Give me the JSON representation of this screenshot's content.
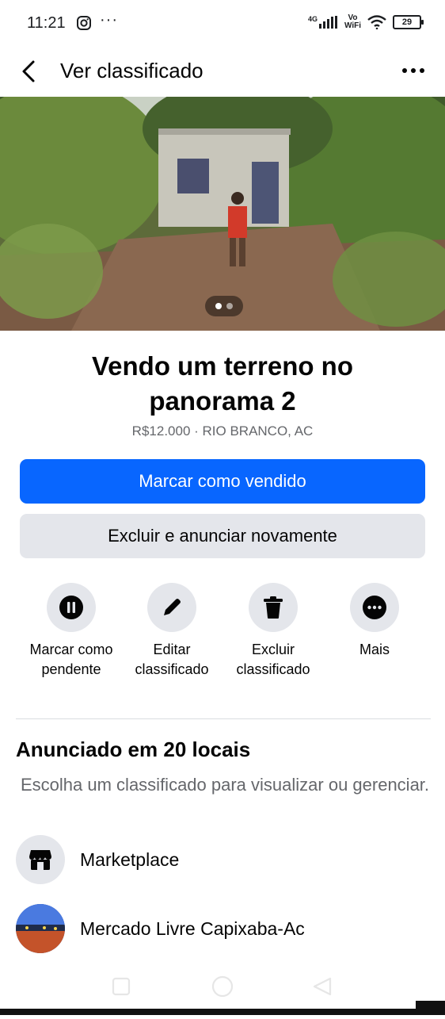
{
  "status_bar": {
    "time": "11:21",
    "dots": "···",
    "network": "4G",
    "volte_top": "Vo",
    "volte_bottom": "WiFi",
    "battery": "29"
  },
  "header": {
    "title": "Ver classificado"
  },
  "photo": {
    "page_count": 2,
    "active_index": 0
  },
  "listing": {
    "title": "Vendo um terreno no panorama 2",
    "meta": "R$12.000 · RIO BRANCO, AC"
  },
  "buttons": {
    "primary_label": "Marcar como vendido",
    "secondary_label": "Excluir e anunciar novamente"
  },
  "actions": [
    {
      "label": "Marcar como pendente",
      "icon": "pause-icon"
    },
    {
      "label": "Editar classificado",
      "icon": "pencil-icon"
    },
    {
      "label": "Excluir classificado",
      "icon": "trash-icon"
    },
    {
      "label": "Mais",
      "icon": "more-icon"
    }
  ],
  "posted": {
    "title": "Anunciado em 20 locais",
    "subtitle": "Escolha um classificado para visualizar ou gerenciar.",
    "places": [
      {
        "label": "Marketplace",
        "icon": "marketplace-store-icon"
      },
      {
        "label": "Mercado Livre Capixaba-Ac",
        "icon": "group-avatar"
      }
    ]
  },
  "colors": {
    "primary": "#0866ff",
    "secondary_bg": "#e4e6eb",
    "text": "#050505",
    "muted": "#65676b"
  }
}
